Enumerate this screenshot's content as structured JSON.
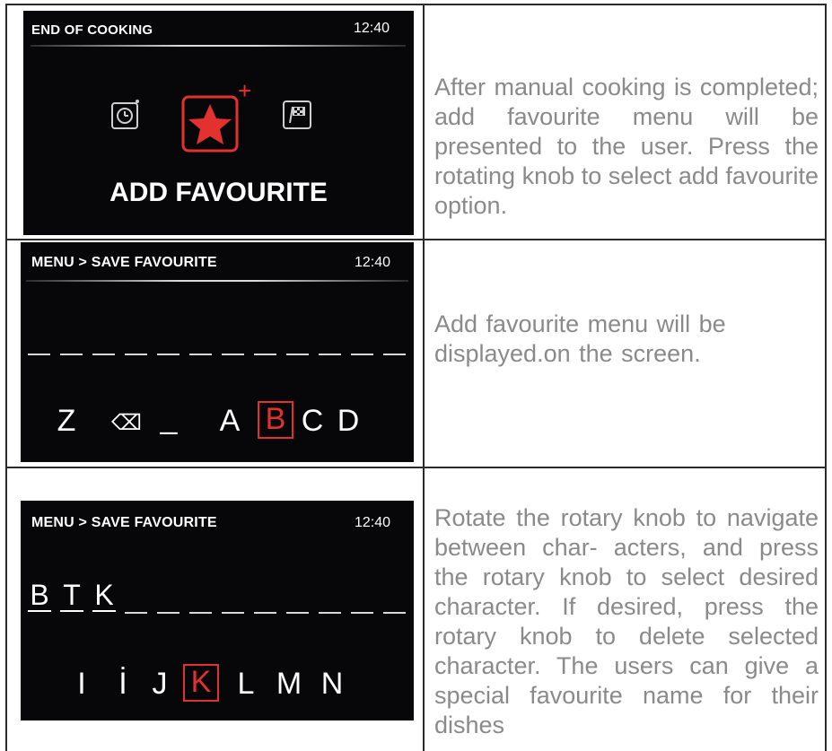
{
  "rows": [
    {
      "screen": {
        "title": "END OF COOKING",
        "time": "12:40",
        "plus_sign": "+",
        "label": "ADD FAVOURITE",
        "icons": [
          "timer-icon",
          "favourite-star-add-icon",
          "finish-flag-icon"
        ]
      },
      "description": "After manual cooking is completed; add favourite menu will be presented to the user. Press the rotating knob to select add favourite option."
    },
    {
      "screen": {
        "title": "MENU > SAVE FAVOURITE",
        "time": "12:40",
        "chars": [
          "Z",
          "⌫",
          "_",
          "A",
          "B",
          "C",
          "D"
        ],
        "selected_char": "B"
      },
      "description": "Add favourite menu will be displayed.on the screen."
    },
    {
      "screen": {
        "title": "MENU > SAVE FAVOURITE",
        "time": "12:40",
        "name_chars": [
          "B",
          "T",
          "K"
        ],
        "chars": [
          "I",
          "İ",
          "J",
          "K",
          "L",
          "M",
          "N"
        ],
        "selected_char": "K"
      },
      "description": "Rotate the rotary knob to navigate between char- acters, and press the rotary knob to select desired character. If desired, press the rotary knob to delete selected character. The users can give a special favourite name for their dishes"
    }
  ],
  "colors": {
    "screen_bg": "#070709",
    "accent_red": "#e2312f",
    "description_text": "#8a8a8a",
    "table_border": "#2b2b2b"
  }
}
